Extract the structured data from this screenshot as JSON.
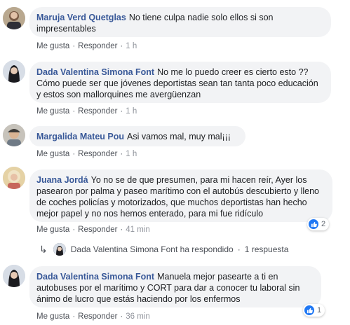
{
  "comments": [
    {
      "author": "Maruja Verd Quetglas",
      "text": "No tiene culpa nadie solo ellos si son impresentables",
      "like": "Me gusta",
      "reply": "Responder",
      "time": "1 h"
    },
    {
      "author": "Dada Valentina Simona Font",
      "text": "No me lo puedo creer es cierto esto ?? Cómo puede ser que jóvenes deportistas sean tan tanta poco educación y estos son mallorquines me avergüenzan",
      "like": "Me gusta",
      "reply": "Responder",
      "time": "1 h"
    },
    {
      "author": "Margalida Mateu Pou",
      "text": "Asi vamos mal, muy mal¡¡¡",
      "like": "Me gusta",
      "reply": "Responder",
      "time": "1 h"
    },
    {
      "author": "Juana Jordá",
      "text": "Yo no se de que presumen, para mi hacen reír, Ayer los pasearon por palma y paseo marítimo con el autobús descubierto y lleno de coches policías y motorizados, que muchos deportistas han hecho mejor papel y no nos hemos enterado, para mi fue ridículo",
      "like": "Me gusta",
      "reply": "Responder",
      "time": "41 min",
      "reactions": "2"
    },
    {
      "author": "Dada Valentina Simona Font",
      "text": "Manuela mejor pasearte a ti en autobuses por el marítimo y CORT para dar a conocer tu laboral sin ánimo de lucro que estás haciendo por los enfermos",
      "like": "Me gusta",
      "reply": "Responder",
      "time": "36 min",
      "reactions": "1"
    }
  ],
  "replies_summary": {
    "author": "Dada Valentina Simona Font",
    "action": "ha respondido",
    "separator": "·",
    "count": "1 respuesta"
  },
  "separator": "·",
  "icons": {
    "like": "thumbs-up-icon",
    "reply_arrow": "reply-arrow-icon"
  },
  "colors": {
    "author": "#385898",
    "bubble": "#f2f3f5",
    "like_badge": "#2078f4"
  }
}
